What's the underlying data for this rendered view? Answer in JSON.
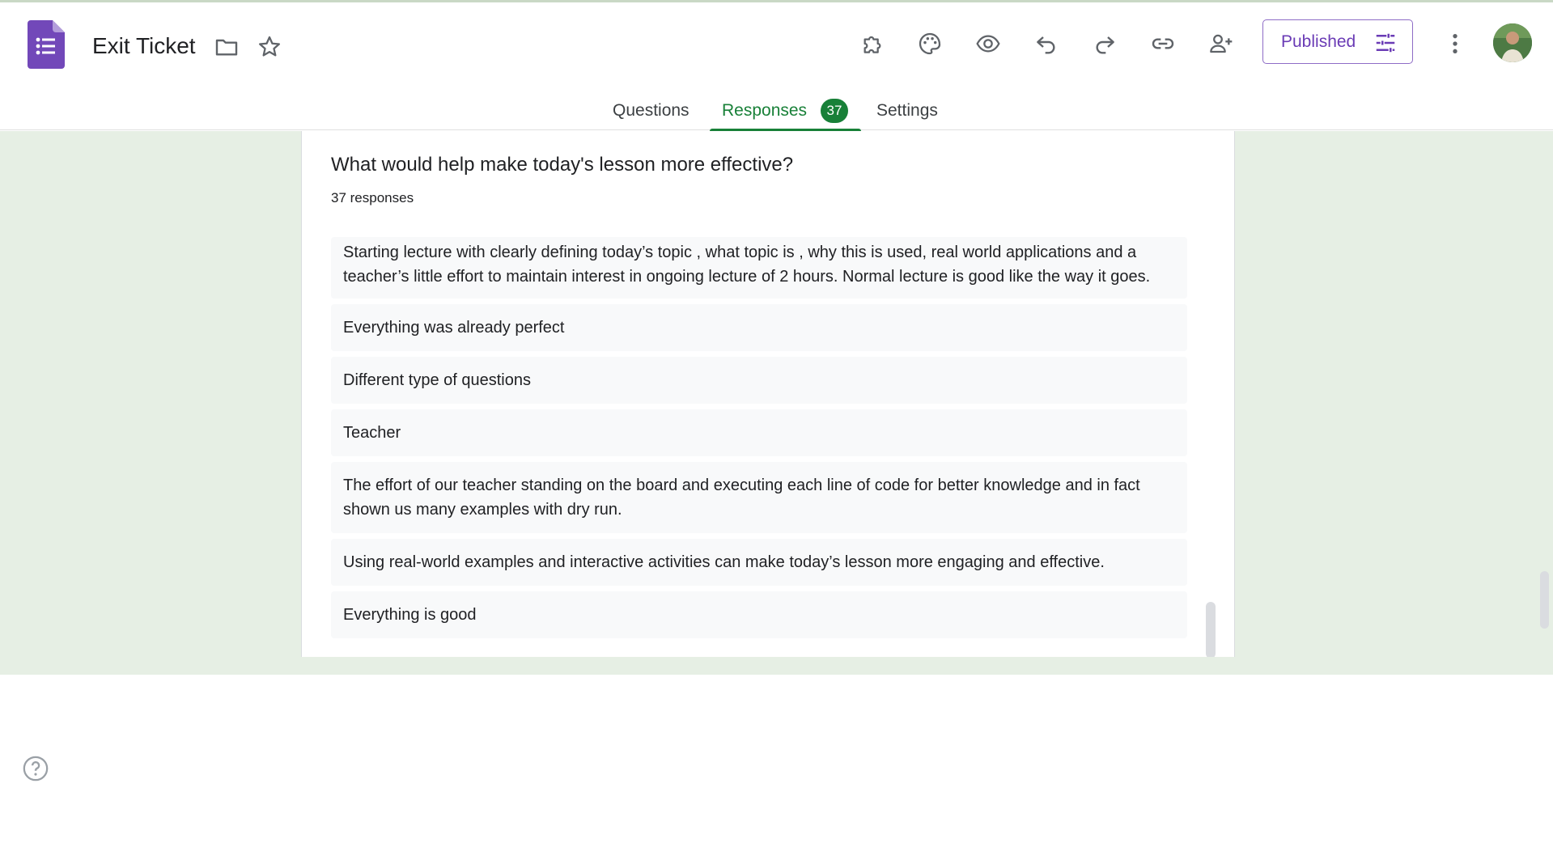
{
  "app": {
    "document_title": "Exit Ticket",
    "publish_button_label": "Published"
  },
  "tabs": [
    {
      "label": "Questions",
      "active": false
    },
    {
      "label": "Responses",
      "active": true,
      "badge": "37"
    },
    {
      "label": "Settings",
      "active": false
    }
  ],
  "question": {
    "title": "What would help make today's lesson more effective?",
    "response_count": "37 responses"
  },
  "responses": [
    "Starting lecture with clearly defining today’s topic , what topic is , why this is used, real world applications and a teacher’s little effort to maintain interest in ongoing lecture of 2 hours. Normal lecture is good like the way it goes.",
    "Everything was already perfect",
    "Different type of questions",
    "Teacher",
    "The effort of our teacher standing on the board and executing each line of code for better knowledge and in fact shown us many examples with dry run.",
    "Using real-world examples and interactive activities can make today’s lesson more engaging and effective.",
    "Everything is good"
  ],
  "icons": {
    "logo": "google-forms-logo",
    "folder": "folder-icon",
    "star": "star-icon",
    "addons": "puzzle-icon",
    "theme": "palette-icon",
    "preview": "eye-icon",
    "undo": "undo-icon",
    "redo": "redo-icon",
    "link": "link-icon",
    "collaborators": "person-add-icon",
    "publish_options": "tune-icon",
    "more": "more-vert-icon",
    "help": "help-icon"
  },
  "colors": {
    "accent_green": "#188038",
    "forms_purple": "#673ab7",
    "canvas_bg": "#e6efe4"
  }
}
